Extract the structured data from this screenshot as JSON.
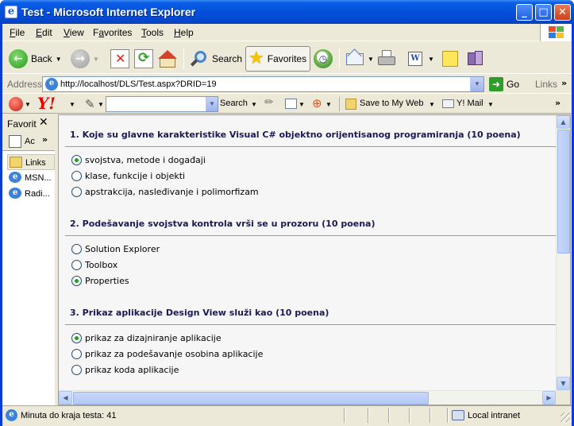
{
  "window": {
    "title": "Test - Microsoft Internet Explorer",
    "controls": {
      "minimize": "_",
      "maximize": "□",
      "close": "✕"
    }
  },
  "menu": {
    "items": [
      {
        "accel": "F",
        "rest": "ile"
      },
      {
        "accel": "E",
        "rest": "dit"
      },
      {
        "accel": "V",
        "rest": "iew"
      },
      {
        "pre": "F",
        "accel": "a",
        "rest": "vorites"
      },
      {
        "accel": "T",
        "rest": "ools"
      },
      {
        "accel": "H",
        "rest": "elp"
      }
    ]
  },
  "toolbar": {
    "back_label": "Back",
    "search_label": "Search",
    "favorites_label": "Favorites"
  },
  "address": {
    "label": "Address",
    "url": "http://localhost/DLS/Test.aspx?DRID=19",
    "go_label": "Go",
    "links_label": "Links"
  },
  "yahoo": {
    "logo": "Y!",
    "search_value": "",
    "search_button": "Search",
    "save_label": "Save to My Web",
    "mail_label": "Y! Mail"
  },
  "favorites_pane": {
    "title": "Favorit",
    "add_label": "Ac",
    "items": [
      {
        "label": "Links",
        "icon": "folder-icon"
      },
      {
        "label": "MSN...",
        "icon": "ie-page-icon"
      },
      {
        "label": "Radi...",
        "icon": "ie-page-icon"
      }
    ]
  },
  "questions": [
    {
      "title": "1. Koje su glavne karakteristike Visual C# objektno orijentisanog programiranja (10 poena)",
      "options": [
        {
          "label": "svojstva, metode i događaji",
          "selected": true
        },
        {
          "label": "klase, funkcije i objekti",
          "selected": false
        },
        {
          "label": "apstrakcija, nasleđivanje i polimorfizam",
          "selected": false
        }
      ]
    },
    {
      "title": "2. Podešavanje svojstva kontrola vrši se u prozoru (10 poena)",
      "options": [
        {
          "label": "Solution Explorer",
          "selected": false
        },
        {
          "label": "Toolbox",
          "selected": false
        },
        {
          "label": "Properties",
          "selected": true
        }
      ]
    },
    {
      "title": "3. Prikaz aplikacije Design View služi kao (10 poena)",
      "options": [
        {
          "label": "prikaz za dizajniranje aplikacije",
          "selected": true
        },
        {
          "label": "prikaz za podešavanje osobina aplikacije",
          "selected": false
        },
        {
          "label": "prikaz koda aplikacije",
          "selected": false
        }
      ]
    }
  ],
  "status": {
    "text": "Minuta do kraja testa: 41",
    "zone": "Local intranet"
  }
}
